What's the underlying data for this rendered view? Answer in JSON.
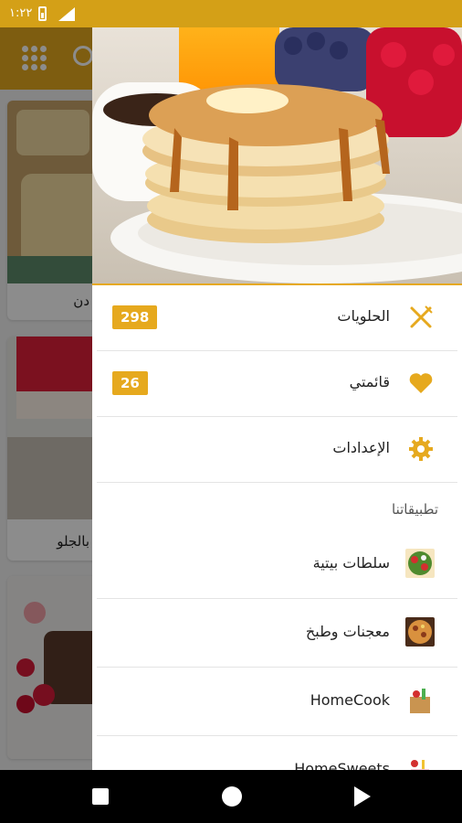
{
  "status_bar": {
    "time": "١:٢٢",
    "color": "#d4a017"
  },
  "background_app": {
    "toolbar_color": "#e6a91e",
    "cards": [
      {
        "caption": "دن"
      },
      {
        "caption": "بالجلو"
      }
    ]
  },
  "drawer": {
    "menu": [
      {
        "label": "الحلويات",
        "badge": "298",
        "icon": "fork-knife-icon"
      },
      {
        "label": "قائمتي",
        "badge": "26",
        "icon": "heart-icon"
      },
      {
        "label": "الإعدادات",
        "icon": "gear-icon"
      }
    ],
    "section_title": "تطبيقاتنا",
    "apps": [
      {
        "label": "سلطات بيتية",
        "icon": "salad-thumb"
      },
      {
        "label": "معجنات وطبخ",
        "icon": "pastry-thumb"
      },
      {
        "label": "HomeCook",
        "icon": "grocery-bag-icon"
      },
      {
        "label": "HomeSweets",
        "icon": "cake-icon"
      }
    ],
    "accent_color": "#e6a91e"
  }
}
